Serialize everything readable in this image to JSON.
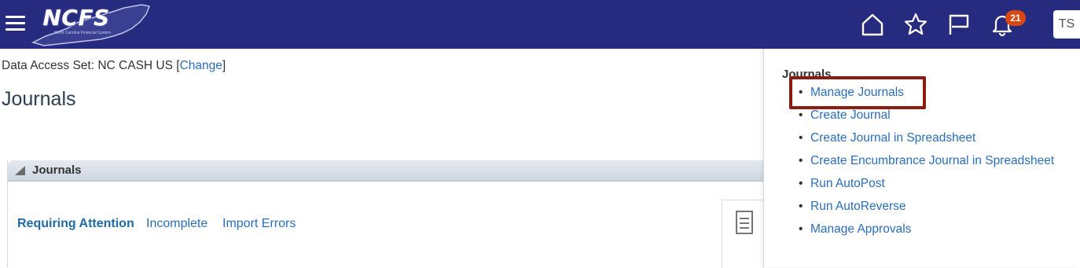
{
  "header": {
    "logo_text": "NCFS",
    "logo_subtext": "North Carolina Financial System",
    "notifications_count": "21",
    "user_initials": "TS",
    "icons": [
      "menu-icon",
      "home-icon",
      "favorites-star-icon",
      "flag-icon",
      "notifications-bell-icon"
    ],
    "colors": {
      "bar": "#262b7f",
      "badge": "#d9480f"
    }
  },
  "main": {
    "data_access_set_label": "Data Access Set:",
    "data_access_set_value": "NC CASH US",
    "change_link": "Change",
    "page_title": "Journals",
    "panel": {
      "title": "Journals",
      "tabs": [
        {
          "label": "Requiring Attention",
          "active": true
        },
        {
          "label": "Incomplete",
          "active": false
        },
        {
          "label": "Import Errors",
          "active": false
        }
      ]
    }
  },
  "tasks": {
    "title": "Journals",
    "items": [
      "Manage Journals",
      "Create Journal",
      "Create Journal in Spreadsheet",
      "Create Encumbrance Journal in Spreadsheet",
      "Run AutoPost",
      "Run AutoReverse",
      "Manage Approvals"
    ],
    "highlighted_item": "Manage Journals",
    "highlight_color": "#8b1d10"
  }
}
